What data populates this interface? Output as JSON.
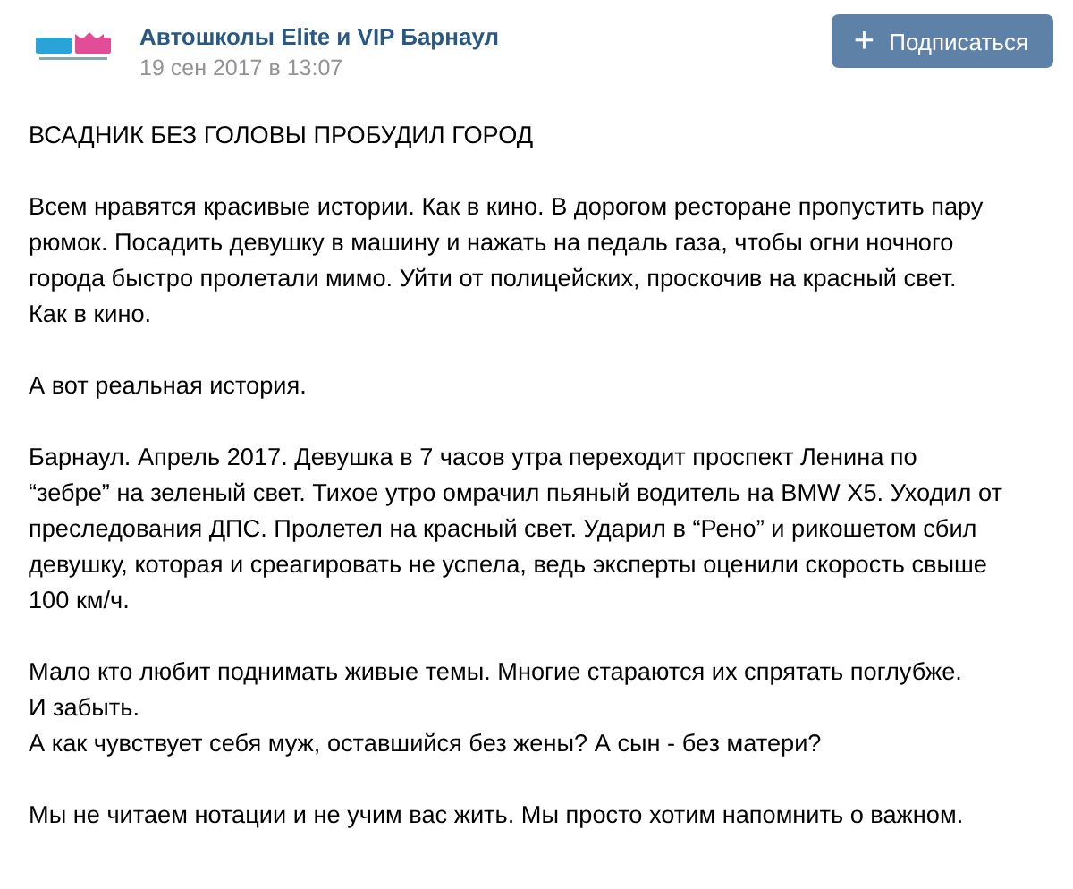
{
  "header": {
    "author": "Автошколы Elite и VIP Барнаул",
    "date": "19 сен 2017 в 13:07",
    "subscribe_button": {
      "icon": "+",
      "label": "Подписаться"
    }
  },
  "post": {
    "title": "ВСАДНИК БЕЗ ГОЛОВЫ ПРОБУДИЛ ГОРОД",
    "paragraphs": [
      {
        "lines": [
          "Всем нравятся красивые истории. Как в кино. В дорогом ресторане пропустить пару",
          "рюмок. Посадить девушку в машину и нажать на педаль газа, чтобы огни ночного",
          "города быстро пролетали мимо. Уйти от полицейских, проскочив на красный свет.",
          "Как в кино."
        ]
      },
      {
        "lines": [
          "А вот реальная история."
        ]
      },
      {
        "lines": [
          "Барнаул. Апрель 2017. Девушка в 7 часов утра переходит проспект Ленина по",
          "“зебре” на зеленый свет. Тихое утро омрачил пьяный водитель на BMW X5. Уходил от",
          "преследования ДПС. Пролетел на красный свет. Ударил в “Рено” и рикошетом сбил",
          "девушку, которая и среагировать не успела, ведь эксперты оценили скорость свыше",
          "100 км/ч."
        ]
      },
      {
        "lines": [
          "Мало кто любит поднимать живые темы. Многие стараются их спрятать поглубже.",
          "И забыть.",
          "А как чувствует себя муж, оставшийся без жены? А сын - без матери?"
        ]
      },
      {
        "lines": [
          "Мы не читаем нотации и не учим вас жить. Мы просто хотим напомнить о важном."
        ]
      }
    ]
  }
}
